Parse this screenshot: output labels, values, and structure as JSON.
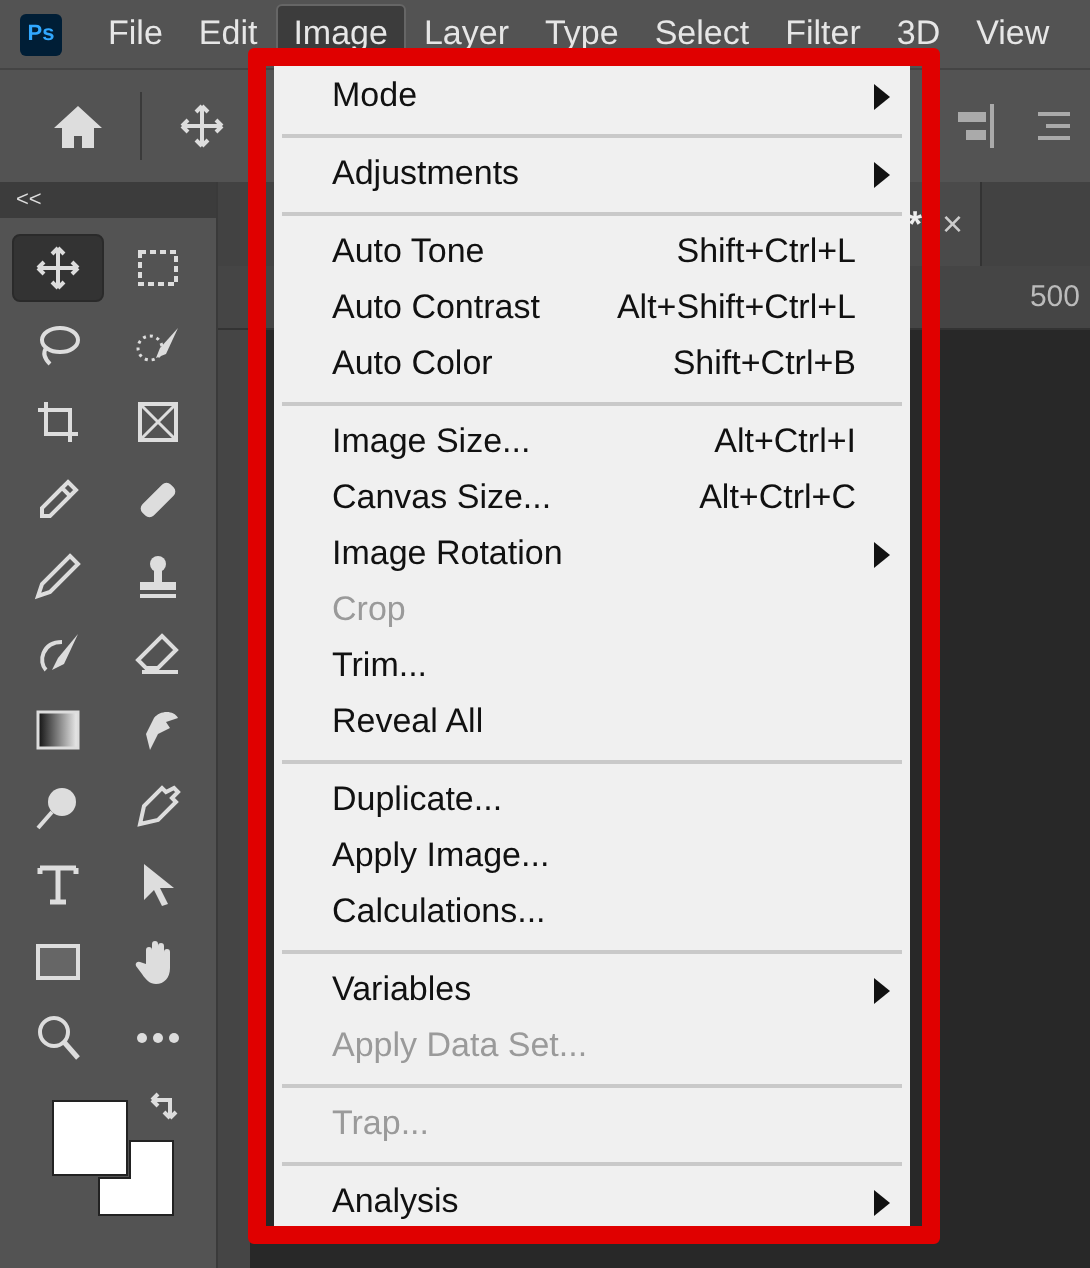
{
  "app_logo": "Ps",
  "menubar": [
    {
      "label": "File",
      "selected": false
    },
    {
      "label": "Edit",
      "selected": false
    },
    {
      "label": "Image",
      "selected": true
    },
    {
      "label": "Layer",
      "selected": false
    },
    {
      "label": "Type",
      "selected": false
    },
    {
      "label": "Select",
      "selected": false
    },
    {
      "label": "Filter",
      "selected": false
    },
    {
      "label": "3D",
      "selected": false
    },
    {
      "label": "View",
      "selected": false
    }
  ],
  "panel_toggle": "<<",
  "tools": [
    {
      "selected": true
    },
    {
      "selected": false
    },
    {
      "selected": false
    },
    {
      "selected": false
    },
    {
      "selected": false
    },
    {
      "selected": false
    },
    {
      "selected": false
    },
    {
      "selected": false
    },
    {
      "selected": false
    },
    {
      "selected": false
    },
    {
      "selected": false
    },
    {
      "selected": false
    },
    {
      "selected": false
    },
    {
      "selected": false
    },
    {
      "selected": false
    },
    {
      "selected": false
    },
    {
      "selected": false
    },
    {
      "selected": false
    },
    {
      "selected": false
    },
    {
      "selected": false
    },
    {
      "selected": false
    },
    {
      "selected": false
    }
  ],
  "document_tab": {
    "modified_mark": "*",
    "close": "×"
  },
  "ruler_label": "500",
  "menu_sections": [
    [
      {
        "label": "Mode",
        "submenu": true,
        "disabled": false
      }
    ],
    [
      {
        "label": "Adjustments",
        "submenu": true,
        "disabled": false
      }
    ],
    [
      {
        "label": "Auto Tone",
        "shortcut": "Shift+Ctrl+L",
        "submenu": false,
        "disabled": false
      },
      {
        "label": "Auto Contrast",
        "shortcut": "Alt+Shift+Ctrl+L",
        "submenu": false,
        "disabled": false
      },
      {
        "label": "Auto Color",
        "shortcut": "Shift+Ctrl+B",
        "submenu": false,
        "disabled": false
      }
    ],
    [
      {
        "label": "Image Size...",
        "shortcut": "Alt+Ctrl+I",
        "submenu": false,
        "disabled": false
      },
      {
        "label": "Canvas Size...",
        "shortcut": "Alt+Ctrl+C",
        "submenu": false,
        "disabled": false
      },
      {
        "label": "Image Rotation",
        "submenu": true,
        "disabled": false
      },
      {
        "label": "Crop",
        "submenu": false,
        "disabled": true
      },
      {
        "label": "Trim...",
        "submenu": false,
        "disabled": false
      },
      {
        "label": "Reveal All",
        "submenu": false,
        "disabled": false
      }
    ],
    [
      {
        "label": "Duplicate...",
        "submenu": false,
        "disabled": false
      },
      {
        "label": "Apply Image...",
        "submenu": false,
        "disabled": false
      },
      {
        "label": "Calculations...",
        "submenu": false,
        "disabled": false
      }
    ],
    [
      {
        "label": "Variables",
        "submenu": true,
        "disabled": false
      },
      {
        "label": "Apply Data Set...",
        "submenu": false,
        "disabled": true
      }
    ],
    [
      {
        "label": "Trap...",
        "submenu": false,
        "disabled": true
      }
    ],
    [
      {
        "label": "Analysis",
        "submenu": true,
        "disabled": false
      }
    ]
  ]
}
